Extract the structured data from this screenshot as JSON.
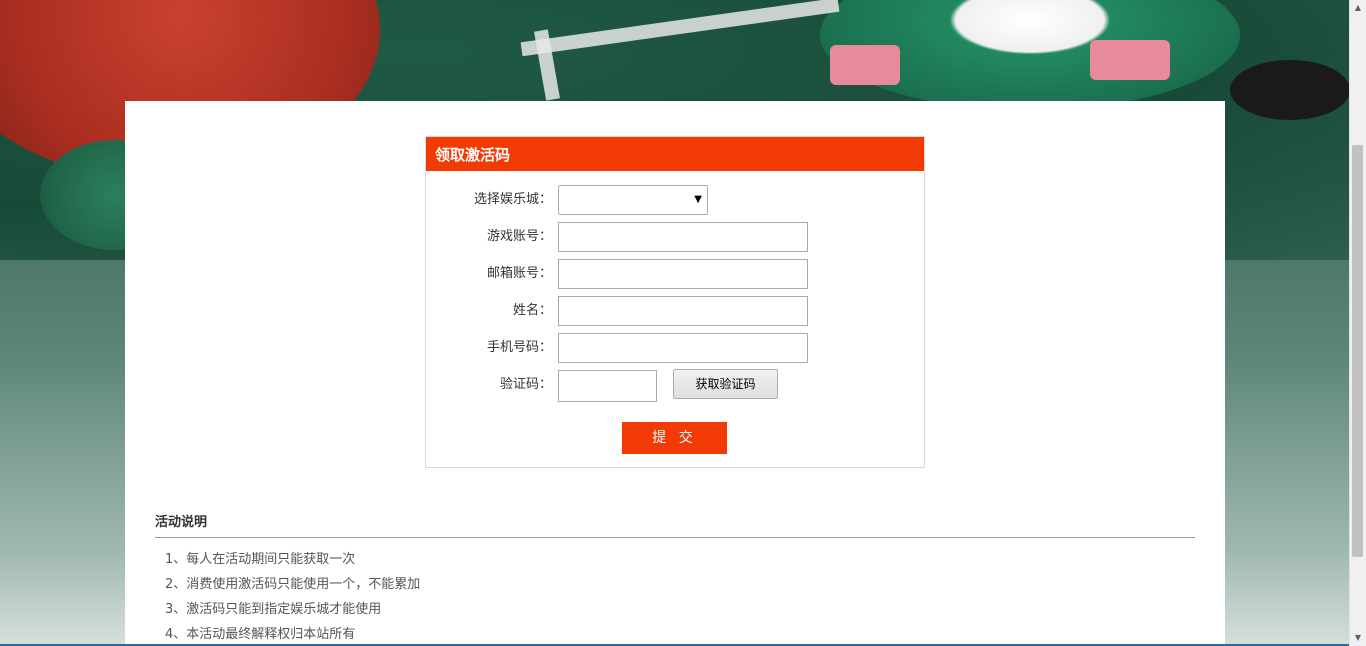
{
  "form": {
    "title": "领取激活码",
    "fields": {
      "casino_label": "选择娱乐城：",
      "casino_value": "",
      "account_label": "游戏账号：",
      "account_value": "",
      "email_label": "邮箱账号：",
      "email_value": "",
      "name_label": "姓名：",
      "name_value": "",
      "phone_label": "手机号码：",
      "phone_value": "",
      "code_label": "验证码：",
      "code_value": ""
    },
    "get_code_label": "获取验证码",
    "submit_label": "提 交"
  },
  "description": {
    "title": "活动说明",
    "items": [
      "1、每人在活动期间只能获取一次",
      "2、消费使用激活码只能使用一个，不能累加",
      "3、激活码只能到指定娱乐城才能使用",
      "4、本活动最终解释权归本站所有"
    ]
  },
  "icons": {
    "select_arrow": "caret-down-icon",
    "scroll_up": "scroll-up-icon",
    "scroll_down": "scroll-down-icon"
  },
  "colors": {
    "accent": "#f23a05",
    "panel_bg": "#ffffff"
  }
}
